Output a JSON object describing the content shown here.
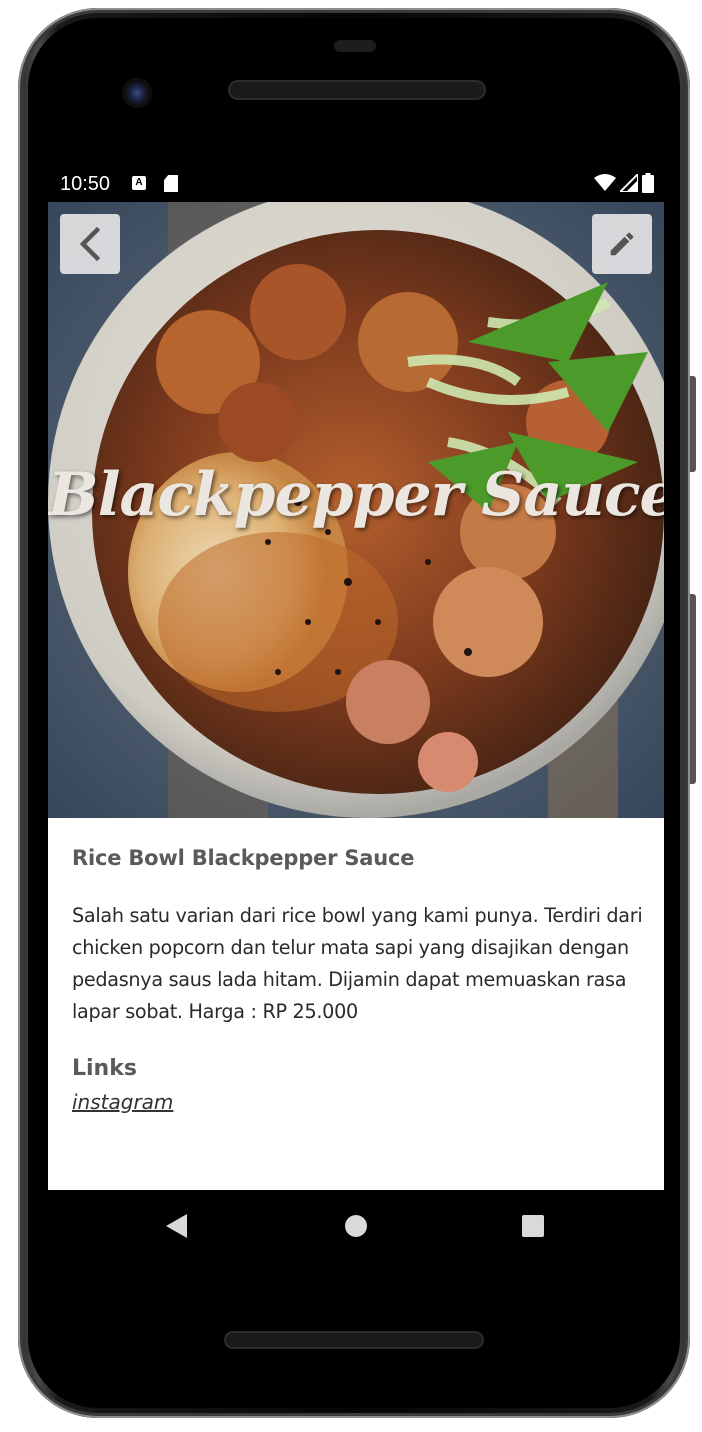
{
  "status_bar": {
    "time": "10:50",
    "icons": [
      "a-notification-icon",
      "sd-card-icon",
      "wifi-icon",
      "signal-icon",
      "battery-icon"
    ]
  },
  "hero": {
    "overlay_text": "Blackpepper Sauce",
    "back_icon": "chevron-left-icon",
    "edit_icon": "pencil-icon"
  },
  "detail": {
    "title": "Rice Bowl Blackpepper Sauce",
    "description": "Salah satu varian dari rice bowl yang kami punya. Terdiri dari chicken popcorn dan telur mata sapi yang disajikan dengan pedasnya saus lada hitam. Dijamin dapat memuaskan rasa lapar sobat. Harga : RP 25.000",
    "links_heading": "Links",
    "links": [
      {
        "label": "instagram"
      }
    ]
  },
  "nav_bar": {
    "back_icon": "triangle-back-icon",
    "home_icon": "circle-home-icon",
    "recent_icon": "square-recents-icon"
  },
  "colors": {
    "title_gray": "#5a5a5a",
    "body_text": "#2a2a2a",
    "button_bg": "#ebebeb"
  }
}
